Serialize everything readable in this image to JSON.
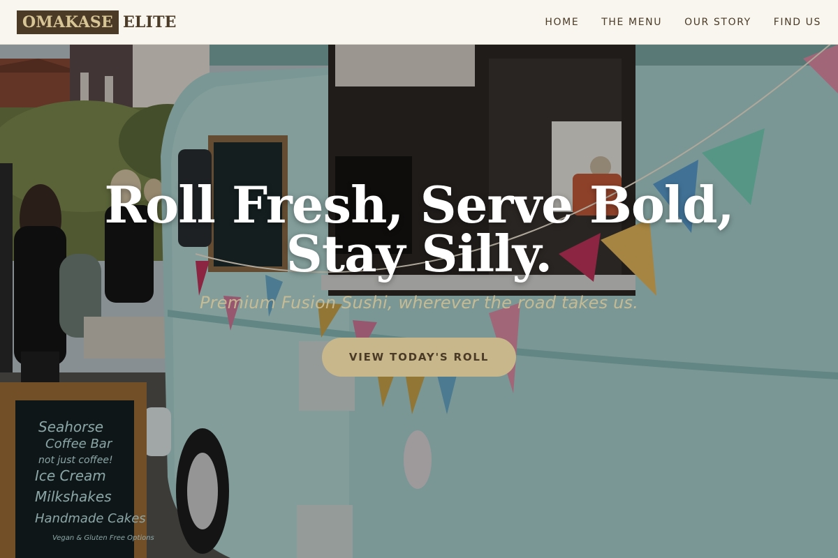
{
  "brand": {
    "logo_box_text": "OMAKASE",
    "logo_text": "ELITE"
  },
  "nav": {
    "items": [
      {
        "label": "HOME"
      },
      {
        "label": "THE MENU"
      },
      {
        "label": "OUR STORY"
      },
      {
        "label": "FIND US"
      }
    ]
  },
  "hero": {
    "headline_line1": "Roll Fresh, Serve Bold,",
    "headline_line2": "Stay Silly.",
    "tagline": "Premium Fusion Sushi, wherever the road takes us.",
    "cta_label": "VIEW TODAY'S ROLL",
    "background_image": "food-truck-photo",
    "sign_text": {
      "line1": "Seahorse",
      "line2": "Coffee Bar",
      "line3": "not just coffee!",
      "line4": "Ice Cream",
      "line5": "Milkshakes",
      "line6": "Handmade Cakes",
      "line7": "Vegan & Gluten Free Options"
    }
  },
  "colors": {
    "header_bg": "#f8f6ef",
    "brand_dark": "#4a3a26",
    "brand_gold": "#d8c596",
    "cta_bg": "#c8b78a",
    "van_teal": "#a9d2cf"
  }
}
